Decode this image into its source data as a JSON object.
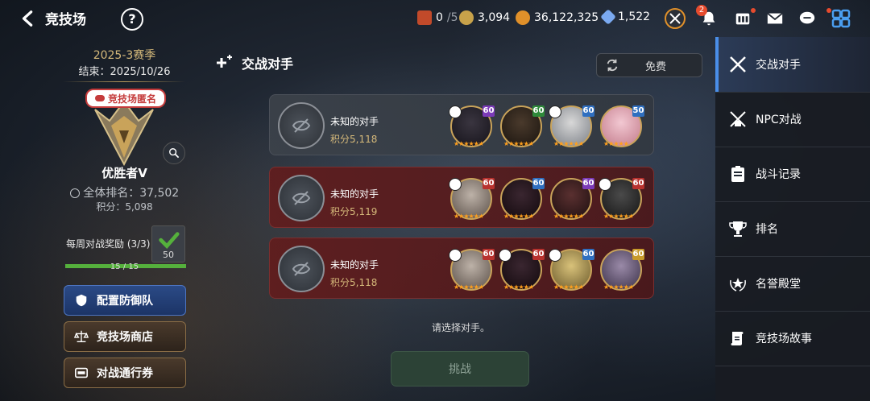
{
  "header": {
    "title": "竞技场",
    "resources": [
      {
        "name": "tickets",
        "value": "0",
        "max": "/5",
        "color": "#c24a2a"
      },
      {
        "name": "honor",
        "value": "3,094",
        "color": "#c8a24a"
      },
      {
        "name": "gold",
        "value": "36,122,325",
        "color": "#e0902a"
      },
      {
        "name": "crystal",
        "value": "1,522",
        "color": "#7aa9f0"
      }
    ],
    "notification_badge": "2"
  },
  "left": {
    "season": "2025-3赛季",
    "season_end": "结束：2025/10/26",
    "anon_label": "竞技场匿名",
    "rank_title": "优胜者V",
    "overall_rank": "全体排名：37,502",
    "points": "积分：5,098",
    "weekly_reward": "每周对战奖励 (3/3)",
    "reward_count": "50",
    "progress_text": "15 / 15",
    "progress_fraction": 1.0,
    "buttons": [
      "配置防御队",
      "竞技场商店",
      "对战通行券"
    ]
  },
  "center": {
    "title": "交战对手",
    "free_label": "免费",
    "opponents": [
      {
        "name": "未知的对手",
        "score": "积分5,118",
        "levels": [
          "60",
          "60",
          "60",
          "50"
        ],
        "level_colors": [
          "#7b3ab8",
          "#2e8a3a",
          "#2f6fc0",
          "#2f6fc0"
        ],
        "theme": "grey"
      },
      {
        "name": "未知的对手",
        "score": "积分5,119",
        "levels": [
          "60",
          "60",
          "60",
          "60"
        ],
        "level_colors": [
          "#b8322e",
          "#2f6fc0",
          "#7b3ab8",
          "#b8322e"
        ],
        "theme": "red"
      },
      {
        "name": "未知的对手",
        "score": "积分5,118",
        "levels": [
          "60",
          "60",
          "60",
          "60"
        ],
        "level_colors": [
          "#b8322e",
          "#b8322e",
          "#2f6fc0",
          "#c89a2a"
        ],
        "theme": "red"
      }
    ],
    "prompt": "请选择对手。",
    "challenge_label": "挑战"
  },
  "right": {
    "tabs": [
      "交战对手",
      "NPC对战",
      "战斗记录",
      "排名",
      "名誉殿堂",
      "竞技场故事"
    ]
  }
}
